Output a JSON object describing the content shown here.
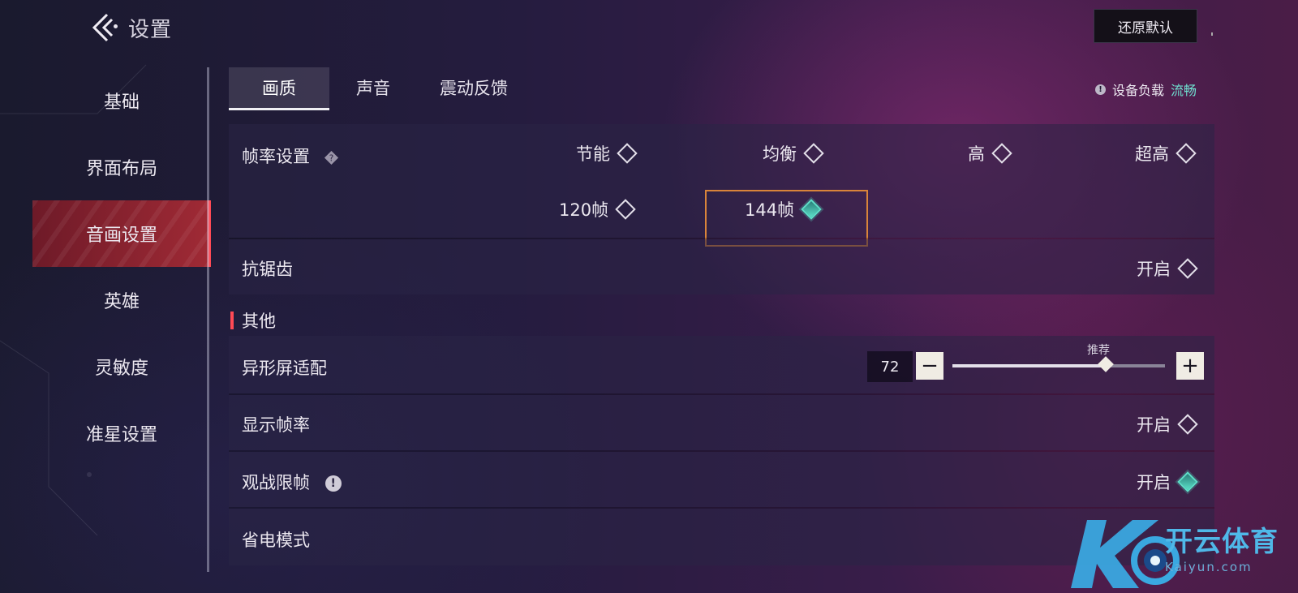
{
  "header": {
    "title": "设置",
    "reset_label": "还原默认"
  },
  "sidebar": {
    "items": [
      {
        "label": "基础",
        "active": false
      },
      {
        "label": "界面布局",
        "active": false
      },
      {
        "label": "音画设置",
        "active": true
      },
      {
        "label": "英雄",
        "active": false
      },
      {
        "label": "灵敏度",
        "active": false
      },
      {
        "label": "准星设置",
        "active": false
      }
    ]
  },
  "tabs": [
    {
      "label": "画质",
      "active": true
    },
    {
      "label": "声音",
      "active": false
    },
    {
      "label": "震动反馈",
      "active": false
    }
  ],
  "device_load": {
    "label": "设备负载",
    "value": "流畅"
  },
  "settings": {
    "frame_rate": {
      "label": "帧率设置",
      "presets": [
        "节能",
        "均衡",
        "高",
        "超高"
      ],
      "fps_options": [
        {
          "label": "120帧",
          "selected": false
        },
        {
          "label": "144帧",
          "selected": true
        }
      ]
    },
    "anti_alias": {
      "label": "抗锯齿",
      "value": "开启",
      "on": false
    },
    "section_other": "其他",
    "notch_fit": {
      "label": "异形屏适配",
      "value": "72",
      "recommend_label": "推荐",
      "level": 0.72
    },
    "show_fps": {
      "label": "显示帧率",
      "value": "开启",
      "on": false
    },
    "spectate_limit": {
      "label": "观战限帧",
      "value": "开启",
      "on": true
    },
    "power_save": {
      "label": "省电模式"
    }
  },
  "watermark": {
    "brand": "开云体育",
    "sub": "Kaiyun.com"
  },
  "colors": {
    "accent_red": "#ff4a55",
    "accent_teal": "#5ce0c8",
    "highlight_orange": "#d9843a"
  }
}
